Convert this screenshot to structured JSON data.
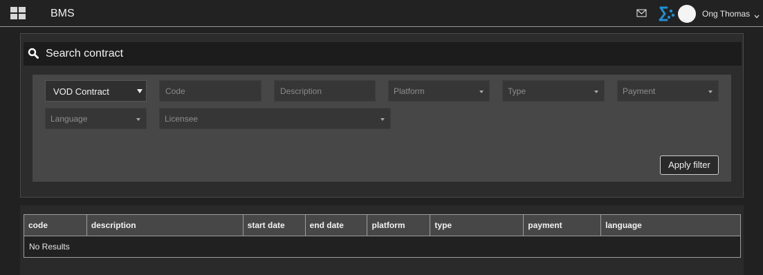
{
  "header": {
    "menu_icon": "grid-icon",
    "app_title": "BMS",
    "mail_icon": "mail-icon",
    "brand_icon": "brand-logo-icon",
    "user_name": "Ong Thomas",
    "user_menu_icon": "chevron-down-icon"
  },
  "search": {
    "icon": "search-icon",
    "title": "Search contract",
    "filters": {
      "contract_type": {
        "value": "VOD Contract"
      },
      "code": {
        "placeholder": "Code"
      },
      "description": {
        "placeholder": "Description"
      },
      "platform": {
        "placeholder": "Platform"
      },
      "type": {
        "placeholder": "Type"
      },
      "payment": {
        "placeholder": "Payment"
      },
      "language": {
        "placeholder": "Language"
      },
      "licensee": {
        "placeholder": "Licensee"
      }
    },
    "apply_label": "Apply filter"
  },
  "results": {
    "columns": [
      "code",
      "description",
      "start date",
      "end date",
      "platform",
      "type",
      "payment",
      "language"
    ],
    "empty_text": "No Results"
  },
  "colors": {
    "background": "#212121",
    "panel": "#2c2c2c",
    "filter_area": "#474747",
    "accent": "#1e90d6"
  }
}
